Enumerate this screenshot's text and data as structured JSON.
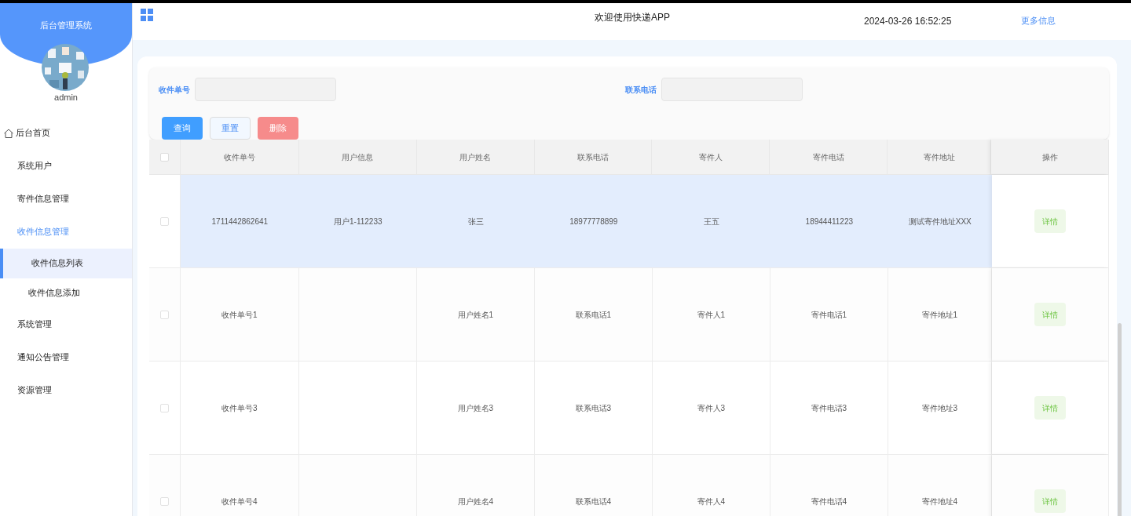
{
  "sidebar": {
    "title": "后台管理系统",
    "user": "admin",
    "items": [
      {
        "label": "后台首页",
        "kind": "home",
        "selected": false
      },
      {
        "label": "系统用户",
        "kind": "menu",
        "selected": false
      },
      {
        "label": "寄件信息管理",
        "kind": "menu",
        "selected": false
      },
      {
        "label": "收件信息管理",
        "kind": "menu",
        "selected": true,
        "children": [
          {
            "label": "收件信息列表",
            "selected": true
          },
          {
            "label": "收件信息添加",
            "selected": false
          }
        ]
      },
      {
        "label": "系统管理",
        "kind": "menu",
        "selected": false
      },
      {
        "label": "通知公告管理",
        "kind": "menu",
        "selected": false
      },
      {
        "label": "资源管理",
        "kind": "menu",
        "selected": false
      }
    ]
  },
  "header": {
    "title": "欢迎使用快递APP",
    "datetime": "2024-03-26 16:52:25",
    "more": "更多信息"
  },
  "search": {
    "fields": [
      {
        "label": "收件单号"
      },
      {
        "label": "联系电话"
      }
    ],
    "buttons": [
      {
        "label": "查询",
        "kind": "primary"
      },
      {
        "label": "重置",
        "kind": "plain"
      },
      {
        "label": "删除",
        "kind": "danger"
      }
    ]
  },
  "table": {
    "select_all_checked": false,
    "columns": [
      "收件单号",
      "用户信息",
      "用户姓名",
      "联系电话",
      "寄件人",
      "寄件电话",
      "寄件地址",
      "操作"
    ],
    "rows": [
      {
        "selected": true,
        "checked": false,
        "cells": [
          "1711442862641",
          "用户1-112233",
          "张三",
          "18977778899",
          "王五",
          "18944411223",
          "测试寄件地址XXX"
        ],
        "action": "详情"
      },
      {
        "selected": false,
        "checked": false,
        "cells": [
          "收件单号1",
          null,
          "用户姓名1",
          "联系电话1",
          "寄件人1",
          "寄件电话1",
          "寄件地址1"
        ],
        "action": "详情"
      },
      {
        "selected": false,
        "checked": false,
        "cells": [
          "收件单号3",
          null,
          "用户姓名3",
          "联系电话3",
          "寄件人3",
          "寄件电话3",
          "寄件地址3"
        ],
        "action": "详情"
      },
      {
        "selected": false,
        "checked": false,
        "cells": [
          "收件单号4",
          null,
          "用户姓名4",
          "联系电话4",
          "寄件人4",
          "寄件电话4",
          "寄件地址4"
        ],
        "action": "详情"
      }
    ]
  }
}
